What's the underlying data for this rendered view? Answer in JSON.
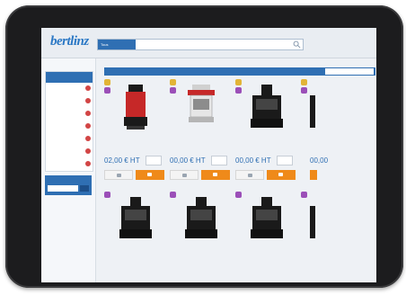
{
  "app": {
    "logo": "bertlinz"
  },
  "search": {
    "category": "Tous"
  },
  "sidebar": {
    "link": "",
    "panel_title": "",
    "filters": [
      {
        "label": "",
        "value": ""
      },
      {
        "label": "",
        "value": ""
      },
      {
        "label": "",
        "value": ""
      },
      {
        "label": "",
        "value": ""
      },
      {
        "label": "",
        "value": ""
      },
      {
        "label": "",
        "value": ""
      },
      {
        "label": "",
        "value": ""
      }
    ],
    "box_title": ""
  },
  "main": {
    "breadcrumb": "",
    "bar_text": "",
    "sort_label": "",
    "sort_value": ""
  },
  "products": [
    {
      "name": "",
      "ref": "",
      "price_label": "",
      "price": "02,00 € HT",
      "stock": ""
    },
    {
      "name": "",
      "ref": "",
      "price_label": "",
      "price": "00,00 € HT",
      "stock": ""
    },
    {
      "name": "",
      "ref": "",
      "price_label": "",
      "price": "00,00 € HT",
      "stock": ""
    },
    {
      "name": "",
      "ref": "",
      "price_label": "",
      "price": "00,00",
      "stock": ""
    },
    {
      "name": "",
      "ref": ""
    },
    {
      "name": "",
      "ref": ""
    },
    {
      "name": "",
      "ref": ""
    },
    {
      "name": "",
      "ref": ""
    }
  ],
  "colors": {
    "accent": "#2f6fb3",
    "cart_button": "#ef8a1a",
    "badge_yellow": "#e2b437",
    "badge_purple": "#9b4fb8",
    "filter_remove": "#d24545"
  }
}
